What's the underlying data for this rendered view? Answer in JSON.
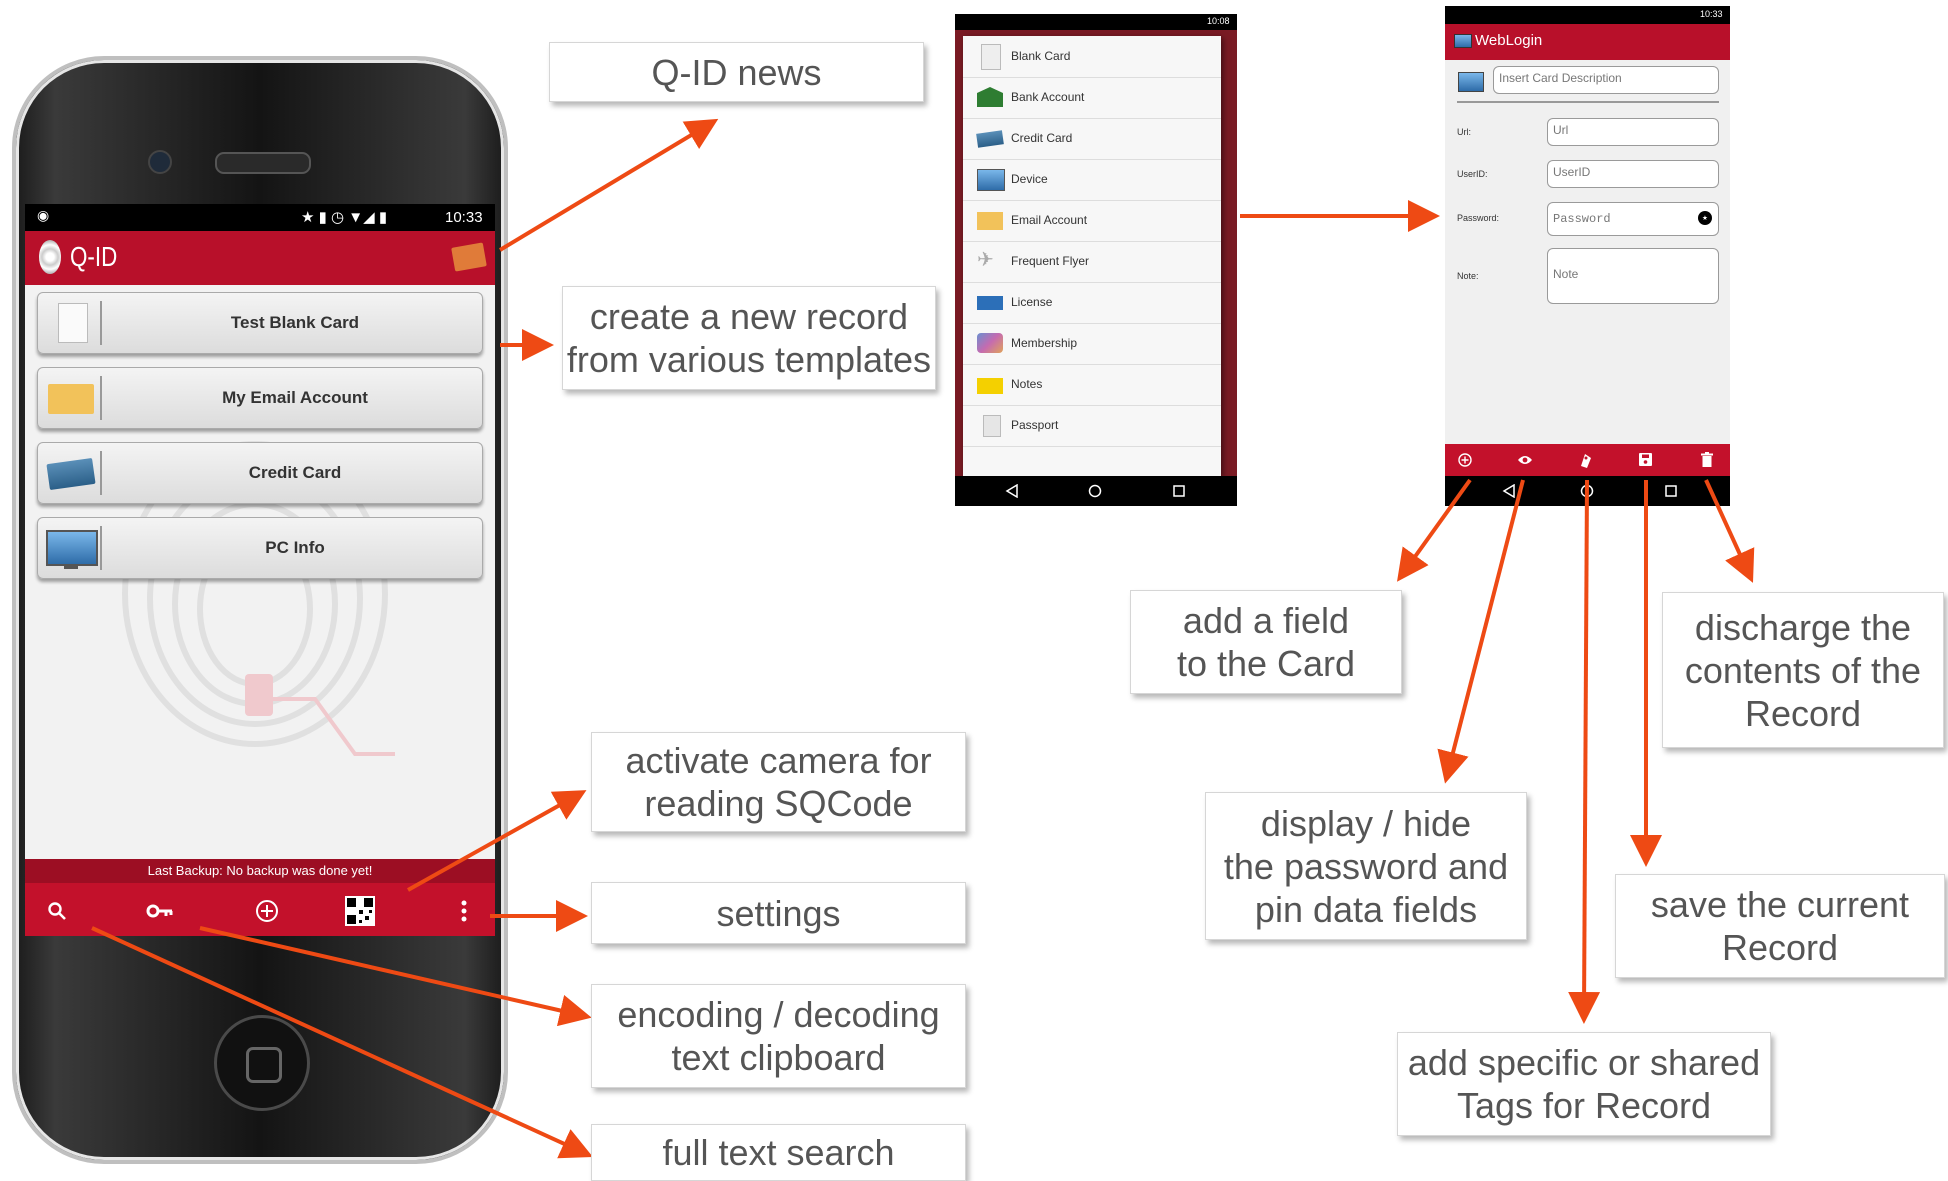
{
  "phone": {
    "status": {
      "time": "10:33"
    },
    "app_title": "Q-ID",
    "cards": [
      {
        "label": "Test Blank Card",
        "icon": "blank-card-icon"
      },
      {
        "label": "My Email Account",
        "icon": "envelope-icon"
      },
      {
        "label": "Credit Card",
        "icon": "credit-card-icon"
      },
      {
        "label": "PC Info",
        "icon": "monitor-icon"
      }
    ],
    "backup_text": "Last Backup: No backup was done yet!",
    "toolbar_icons": [
      "search-icon",
      "key-icon",
      "add-circle-icon",
      "qr-code-icon",
      "more-vert-icon"
    ]
  },
  "template_menu": {
    "status": {
      "time": "10:08"
    },
    "items": [
      {
        "label": "Blank Card",
        "icon": "blank-card-icon"
      },
      {
        "label": "Bank Account",
        "icon": "bank-icon"
      },
      {
        "label": "Credit Card",
        "icon": "credit-card-icon"
      },
      {
        "label": "Device",
        "icon": "monitor-icon"
      },
      {
        "label": "Email Account",
        "icon": "envelope-icon"
      },
      {
        "label": "Frequent Flyer",
        "icon": "airplane-icon"
      },
      {
        "label": "License",
        "icon": "license-icon"
      },
      {
        "label": "Membership",
        "icon": "membership-icon"
      },
      {
        "label": "Notes",
        "icon": "notes-icon"
      },
      {
        "label": "Passport",
        "icon": "passport-icon"
      }
    ]
  },
  "weblogin": {
    "status": {
      "time": "10:33"
    },
    "title": "WebLogin",
    "description_placeholder": "Insert Card Description",
    "fields": [
      {
        "label": "Url:",
        "placeholder": "Url"
      },
      {
        "label": "UserID:",
        "placeholder": "UserID"
      },
      {
        "label": "Password:",
        "placeholder": "Password"
      },
      {
        "label": "Note:",
        "placeholder": "Note"
      }
    ],
    "toolbar_icons": [
      "add-circle-icon",
      "eye-icon",
      "tags-icon",
      "save-icon",
      "trash-icon"
    ]
  },
  "callouts": {
    "news": [
      "Q-ID news"
    ],
    "create": [
      "create a new record",
      "from various templates"
    ],
    "camera": [
      "activate camera for",
      "reading SQCode"
    ],
    "settings": [
      "settings"
    ],
    "encoding": [
      "encoding / decoding",
      "text clipboard"
    ],
    "search": [
      "full text search"
    ],
    "add_field": [
      "add a field",
      "to the Card"
    ],
    "display": [
      "display / hide",
      "the password and",
      "pin  data fields"
    ],
    "tags": [
      "add specific or shared",
      "Tags for Record"
    ],
    "discharge": [
      "discharge  the",
      "contents of the",
      "Record"
    ],
    "save": [
      "save the current",
      "Record"
    ]
  },
  "colors": {
    "accent": "#c3112b",
    "arrow": "#ee4a14"
  }
}
